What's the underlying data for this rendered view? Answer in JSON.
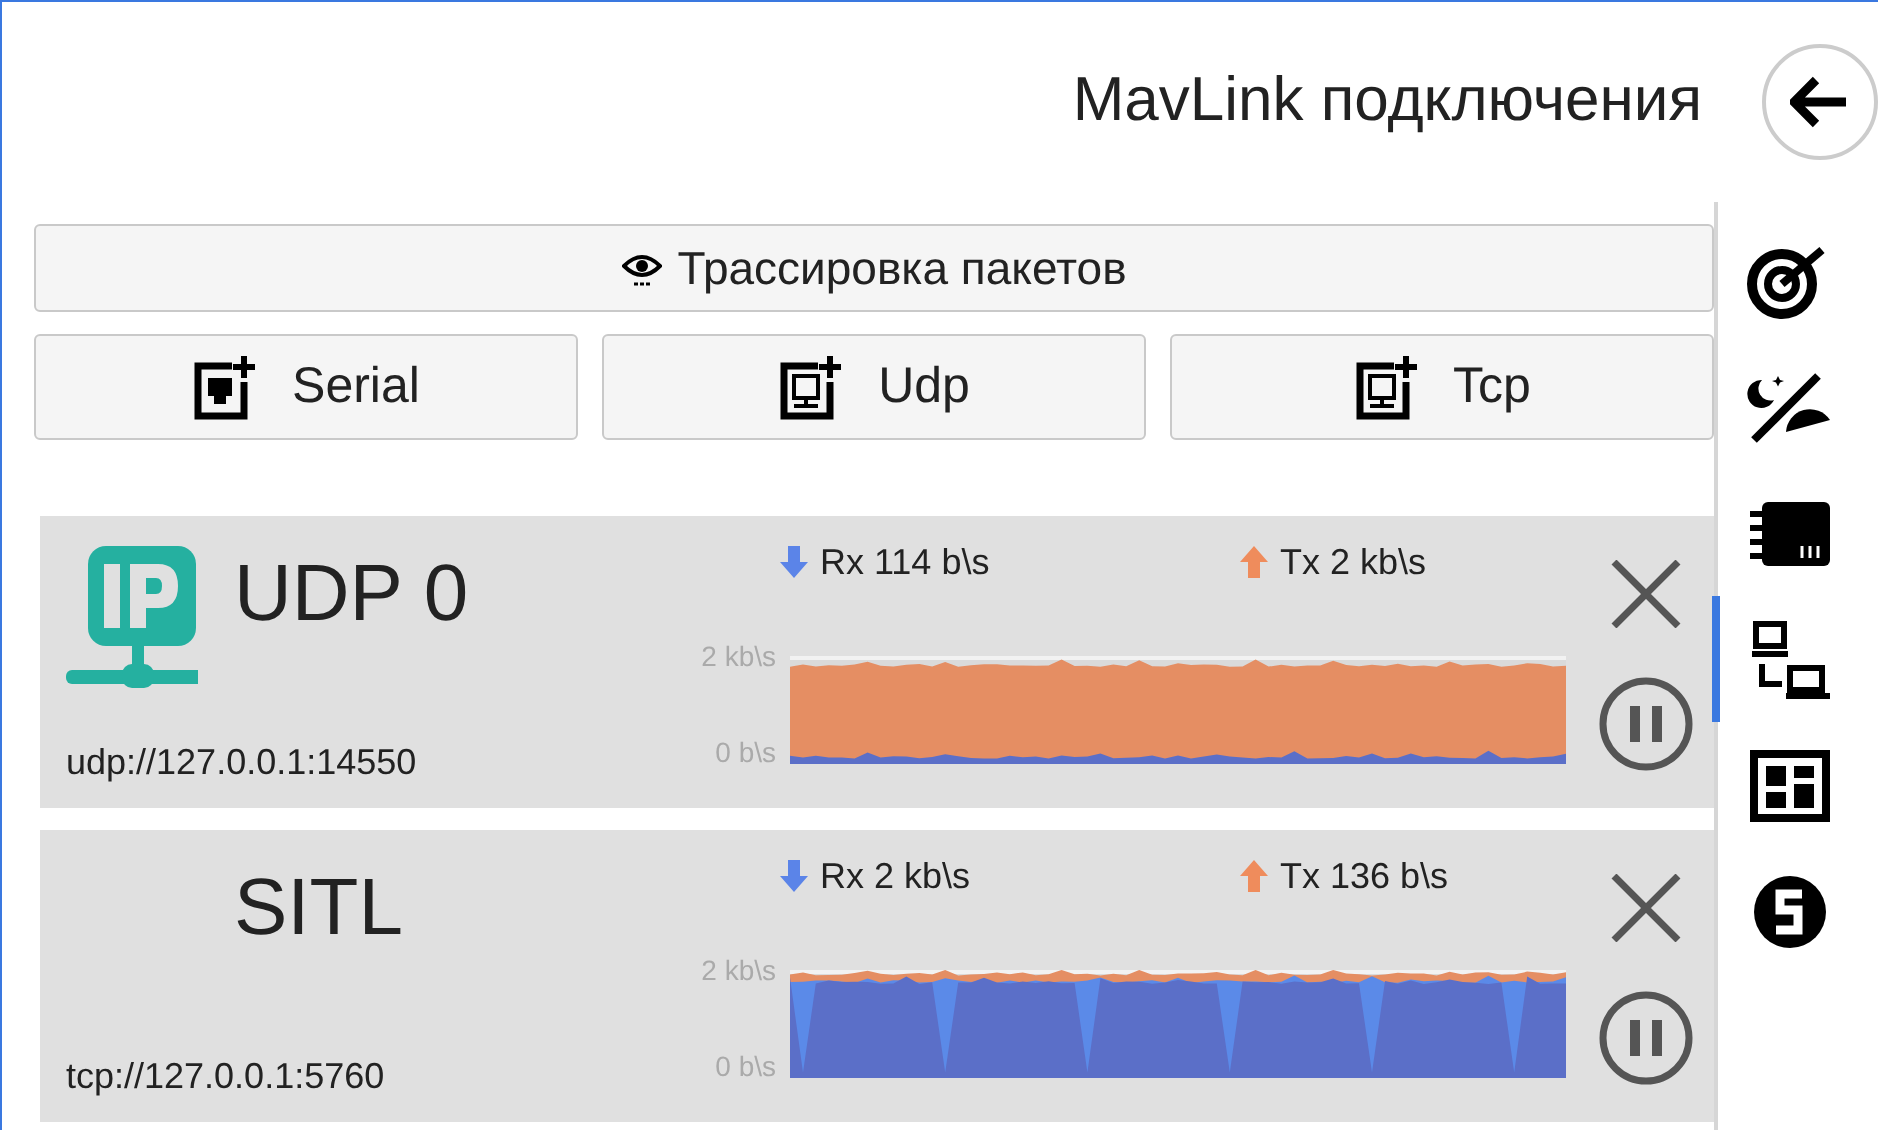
{
  "header": {
    "title": "MavLink подключения"
  },
  "actions": {
    "trace": {
      "label": "Трассировка пакетов"
    },
    "add_buttons": [
      {
        "label": "Serial",
        "kind": "serial"
      },
      {
        "label": "Udp",
        "kind": "ip"
      },
      {
        "label": "Tcp",
        "kind": "ip"
      }
    ]
  },
  "connections": [
    {
      "name": "UDP 0",
      "show_icon": true,
      "address": "udp://127.0.0.1:14550",
      "rx": "Rx 114 b\\s",
      "tx": "Tx 2 kb\\s",
      "axis_top": "2 kb\\s",
      "axis_bottom": "0 b\\s",
      "graph": {
        "kind": "tx_dominant"
      }
    },
    {
      "name": "SITL",
      "show_icon": false,
      "address": "tcp://127.0.0.1:5760",
      "rx": "Rx 2 kb\\s",
      "tx": "Tx 136 b\\s",
      "axis_top": "2 kb\\s",
      "axis_bottom": "0 b\\s",
      "graph": {
        "kind": "rx_dominant"
      }
    }
  ],
  "sidebar": {
    "items": [
      {
        "kind": "target",
        "selected": false
      },
      {
        "kind": "daynight",
        "selected": false
      },
      {
        "kind": "chip",
        "selected": false
      },
      {
        "kind": "network",
        "selected": true
      },
      {
        "kind": "layout",
        "selected": false
      },
      {
        "kind": "logo",
        "selected": false
      }
    ]
  }
}
